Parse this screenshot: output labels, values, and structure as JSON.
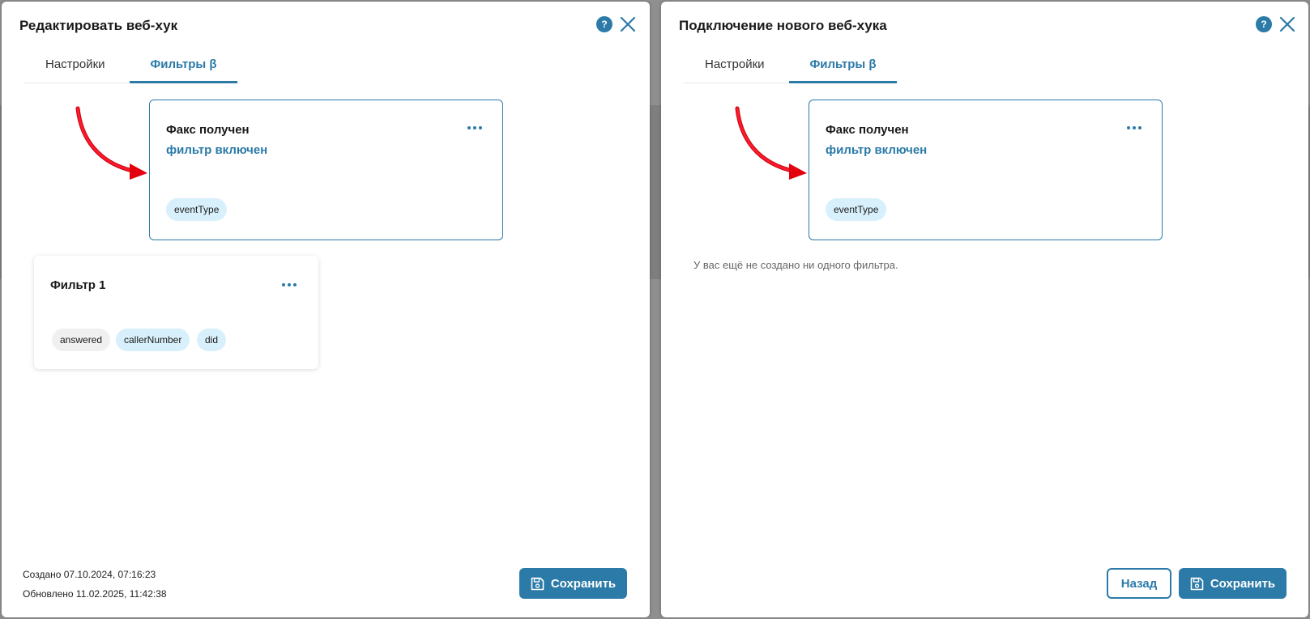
{
  "colors": {
    "accent": "#2b7aa8",
    "chip_blue": "#d8f0fb",
    "chip_gray": "#f0f0f0",
    "arrow_red": "#e3000f"
  },
  "left_modal": {
    "title": "Редактировать веб-хук",
    "tabs": [
      {
        "label": "Настройки",
        "active": false
      },
      {
        "label": "Фильтры β",
        "active": true
      }
    ],
    "highlight_card": {
      "title": "Факс получен",
      "status": "фильтр включен",
      "chips": [
        "eventType"
      ]
    },
    "filter_card": {
      "title": "Фильтр 1",
      "chips": [
        "answered",
        "callerNumber",
        "did"
      ]
    },
    "created": "Создано 07.10.2024, 07:16:23",
    "updated": "Обновлено 11.02.2025, 11:42:38",
    "save_label": "Сохранить",
    "help_glyph": "?"
  },
  "right_modal": {
    "title": "Подключение нового веб-хука",
    "tabs": [
      {
        "label": "Настройки",
        "active": false
      },
      {
        "label": "Фильтры β",
        "active": true
      }
    ],
    "highlight_card": {
      "title": "Факс получен",
      "status": "фильтр включен",
      "chips": [
        "eventType"
      ]
    },
    "empty_text": "У вас ещё не создано ни одного фильтра.",
    "back_label": "Назад",
    "save_label": "Сохранить",
    "help_glyph": "?"
  },
  "icons": {
    "help": "help-icon",
    "close": "close-icon",
    "more": "more-dots-icon",
    "save": "floppy-disk-icon",
    "arrow": "red-arrow-annotation"
  }
}
